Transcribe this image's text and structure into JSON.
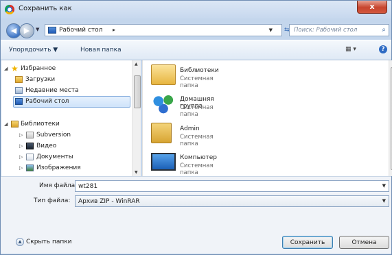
{
  "window": {
    "title": "Сохранить как",
    "close_glyph": "x"
  },
  "address": {
    "location": "Рабочий стол",
    "separator": "▸",
    "search_placeholder": "Поиск: Рабочий стол"
  },
  "toolbar": {
    "organize": "Упорядочить ▼",
    "new_folder": "Новая папка"
  },
  "nav": {
    "favorites": "Избранное",
    "downloads": "Загрузки",
    "recent": "Недавние места",
    "desktop": "Рабочий стол",
    "libraries": "Библиотеки",
    "subversion": "Subversion",
    "video": "Видео",
    "documents": "Документы",
    "images": "Изображения"
  },
  "files": [
    {
      "name": "Библиотеки",
      "type": "Системная папка"
    },
    {
      "name": "Домашняя группа",
      "type": "Системная папка"
    },
    {
      "name": "Admin",
      "type": "Системная папка"
    },
    {
      "name": "Компьютер",
      "type": "Системная папка"
    }
  ],
  "form": {
    "filename_label": "Имя файла:",
    "filename_value": "wt281",
    "filetype_label": "Тип файла:",
    "filetype_value": "Архив ZIP - WinRAR"
  },
  "buttons": {
    "hide_folders": "Скрыть папки",
    "save": "Сохранить",
    "cancel": "Отмена"
  },
  "icons": {
    "app": "chrome-icon",
    "back": "back-arrow-icon",
    "forward": "forward-arrow-icon",
    "refresh": "refresh-icon",
    "search": "search-icon",
    "help": "help-icon",
    "star": "star-icon",
    "folder": "folder-icon"
  },
  "colors": {
    "chrome": "#c4d6ec",
    "close": "#c7452e",
    "selection": "#cfe3fa"
  }
}
